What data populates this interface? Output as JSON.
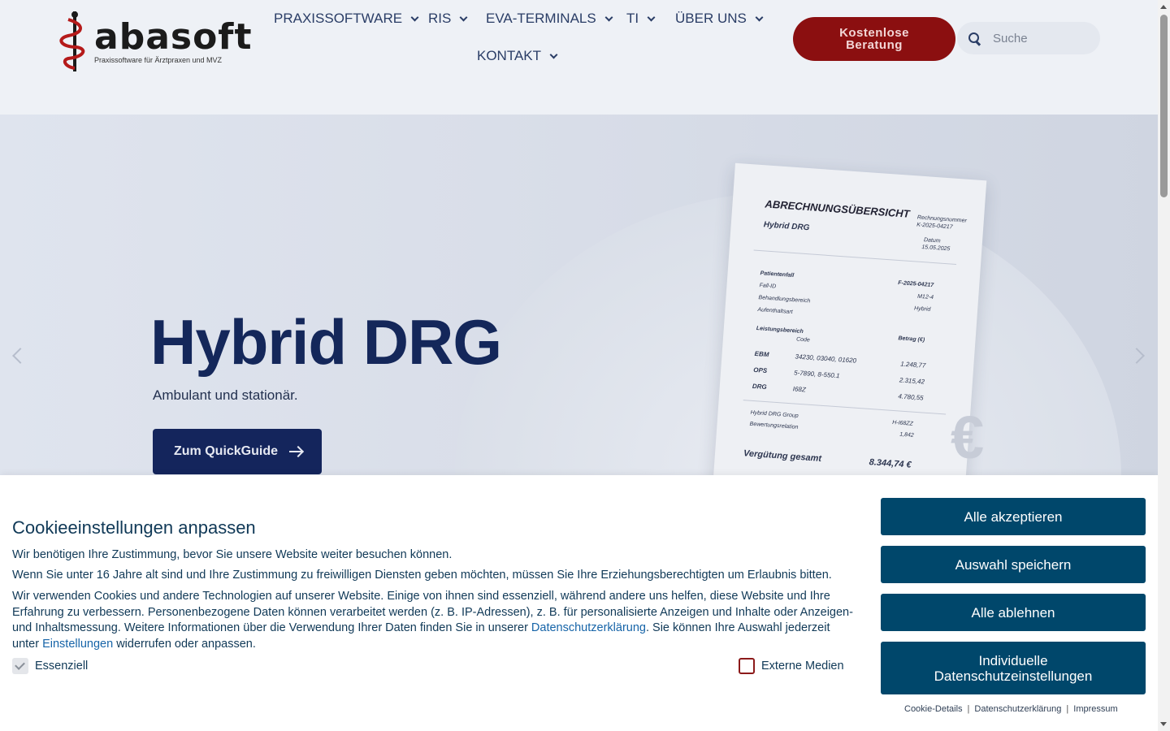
{
  "brand": {
    "logo_text": "abasoft",
    "logo_tagline": "Praxissoftware für Ärztpraxen und MVZ"
  },
  "nav": {
    "items": [
      {
        "label": "PRAXISSOFTWARE"
      },
      {
        "label": "RIS"
      },
      {
        "label": "EVA-TERMINALS"
      },
      {
        "label": "TI"
      },
      {
        "label": "ÜBER UNS"
      },
      {
        "label": "KONTAKT"
      }
    ],
    "cta_label": "Kostenlose Beratung",
    "search_placeholder": "Suche"
  },
  "hero": {
    "title": "Hybrid DRG",
    "subtitle": "Ambulant und stationär.",
    "button_label": "Zum QuickGuide",
    "invoice": {
      "title": "ABRECHNUNGSÜBERSICHT",
      "subtitle": "Hybrid DRG",
      "meta_number_label": "Rechnungsnummer",
      "meta_number": "K-2025-04217",
      "meta_date_label": "Datum",
      "meta_date": "15.05.2025",
      "patient_label": "Patientenfall",
      "patient_value": "F-2025-04217",
      "fall_id_label": "Fall-ID",
      "fall_id_value": "M12-4",
      "bereich_label": "Behandlungsbereich",
      "bereich_value": "Hybrid",
      "aufenthalt_label": "Aufenthaltsart",
      "leistung_label": "Leistungsbereich",
      "code_label": "Code",
      "betrag_label": "Betrag (€)",
      "rows": [
        {
          "name": "EBM",
          "code": "34230, 03040, 01620",
          "amount": "1.248,77"
        },
        {
          "name": "OPS",
          "code": "5-7890, 8-550.1",
          "amount": "2.315,42"
        },
        {
          "name": "DRG",
          "code": "I68Z",
          "amount": "4.780,55"
        }
      ],
      "group_label": "Hybrid DRG Group",
      "group_value": "H-I68ZZ",
      "relation_label": "Bewertungsrelation",
      "relation_value": "1,842",
      "total_label": "Vergütung gesamt",
      "total_value": "8.344,74 €"
    }
  },
  "cookie": {
    "title": "Cookieeinstellungen anpassen",
    "p1": "Wir benötigen Ihre Zustimmung, bevor Sie unsere Website weiter besuchen können.",
    "p2": "Wenn Sie unter 16 Jahre alt sind und Ihre Zustimmung zu freiwilligen Diensten geben möchten, müssen Sie Ihre Erziehungsberechtigten um Erlaubnis bitten.",
    "p3_a": "Wir verwenden Cookies und andere Technologien auf unserer Website. Einige von ihnen sind essenziell, während andere uns helfen, diese Website und Ihre Erfahrung zu verbessern. Personenbezogene Daten können verarbeitet werden (z. B. IP-Adressen), z. B. für personalisierte Anzeigen und Inhalte oder Anzeigen- und Inhaltsmessung. Weitere Informationen über die Verwendung Ihrer Daten finden Sie in unserer ",
    "p3_link1": "Datenschutzerklärung",
    "p3_b": ". Sie können Ihre Auswahl jederzeit unter ",
    "p3_link2": "Einstellungen",
    "p3_c": " widerrufen oder anpassen.",
    "checkbox_essential": "Essenziell",
    "checkbox_external": "Externe Medien",
    "buttons": {
      "accept_all": "Alle akzeptieren",
      "save": "Auswahl speichern",
      "reject_all": "Alle ablehnen",
      "individual": "Individuelle Datenschutzeinstellungen"
    },
    "links": {
      "details": "Cookie-Details",
      "privacy": "Datenschutzerklärung",
      "imprint": "Impressum",
      "separator": "|"
    }
  },
  "colors": {
    "header_bg": "#eef1f6",
    "cta_bg": "#8b0f10",
    "hero_title": "#14275a",
    "cookie_button": "#00476b",
    "cookie_text": "#103957",
    "link": "#1664a8"
  }
}
